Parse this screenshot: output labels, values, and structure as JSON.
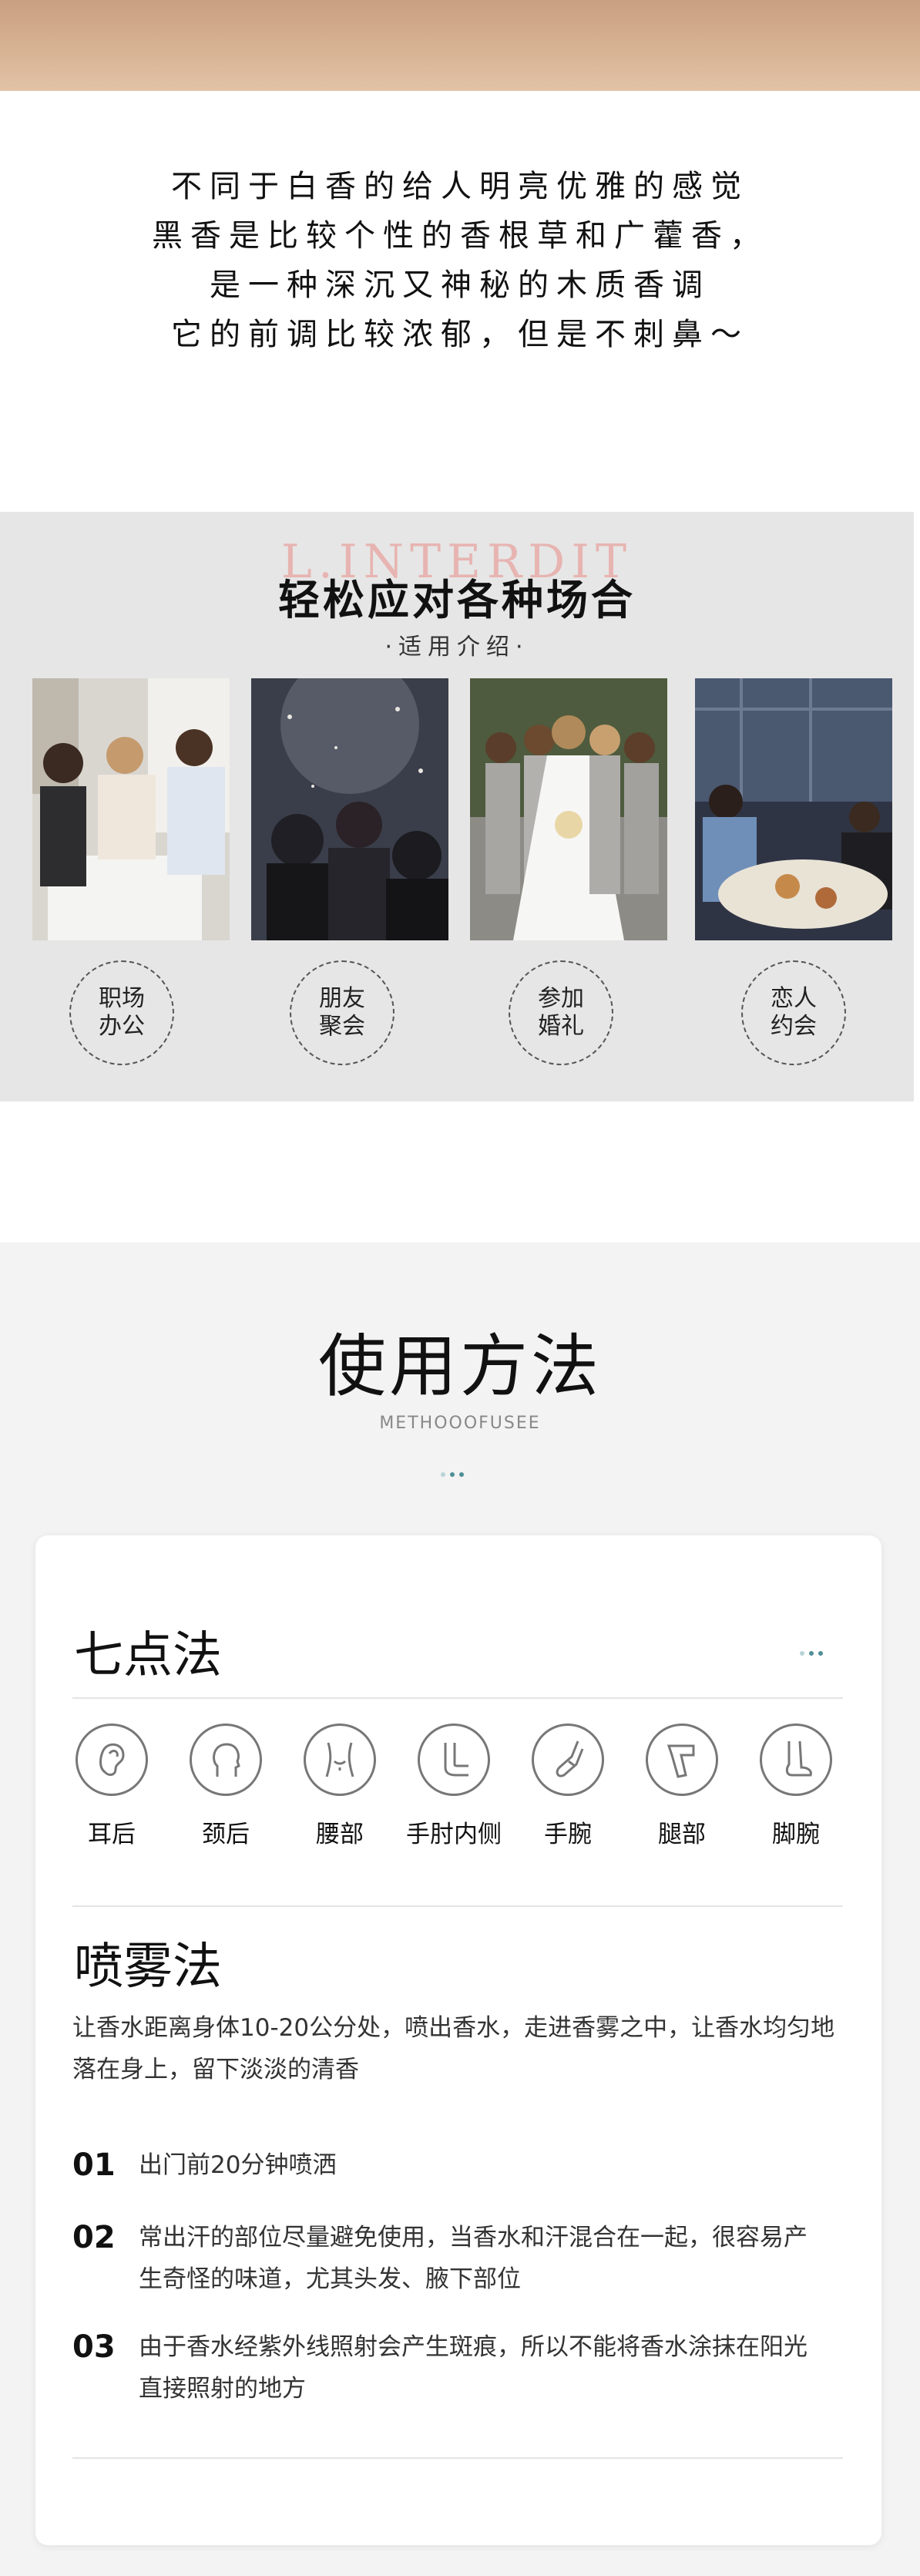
{
  "intro": {
    "lines": [
      "不同于白香的给人明亮优雅的感觉",
      "黑香是比较个性的香根草和广藿香，",
      "是一种深沉又神秘的木质香调",
      "它的前调比较浓郁，但是不刺鼻～"
    ]
  },
  "scenes": {
    "watermark": "L.INTERDIT",
    "title": "轻松应对各种场合",
    "subtitle": "·适用介绍·",
    "items": [
      {
        "label": "职场办公",
        "photo": "office-meeting-photo"
      },
      {
        "label": "朋友聚会",
        "photo": "friends-party-photo"
      },
      {
        "label": "参加婚礼",
        "photo": "wedding-photo"
      },
      {
        "label": "恋人约会",
        "photo": "date-dinner-photo"
      }
    ]
  },
  "method": {
    "title": "使用方法",
    "subtitle": "METHOOOFUSEE",
    "seven_point": {
      "title": "七点法",
      "points": [
        {
          "label": "耳后",
          "icon": "ear-icon"
        },
        {
          "label": "颈后",
          "icon": "neck-icon"
        },
        {
          "label": "腰部",
          "icon": "waist-icon"
        },
        {
          "label": "手肘内侧",
          "icon": "elbow-icon"
        },
        {
          "label": "手腕",
          "icon": "wrist-icon"
        },
        {
          "label": "腿部",
          "icon": "leg-icon"
        },
        {
          "label": "脚腕",
          "icon": "ankle-icon"
        }
      ]
    },
    "spray": {
      "title": "喷雾法",
      "description": "让香水距离身体10-20公分处，喷出香水，走进香雾之中，让香水均匀地落在身上，留下淡淡的清香",
      "steps": [
        {
          "num": "01",
          "text": "出门前20分钟喷洒"
        },
        {
          "num": "02",
          "text": "常出汗的部位尽量避免使用，当香水和汗混合在一起，很容易产生奇怪的味道，尤其头发、腋下部位"
        },
        {
          "num": "03",
          "text": "由于香水经紫外线照射会产生斑痕，所以不能将香水涂抹在阳光直接照射的地方"
        }
      ]
    }
  },
  "colors": {
    "accent_dot_dark": "#4f8f96",
    "accent_dot_light": "#b9d3d6",
    "band_top": "#c9a081"
  }
}
